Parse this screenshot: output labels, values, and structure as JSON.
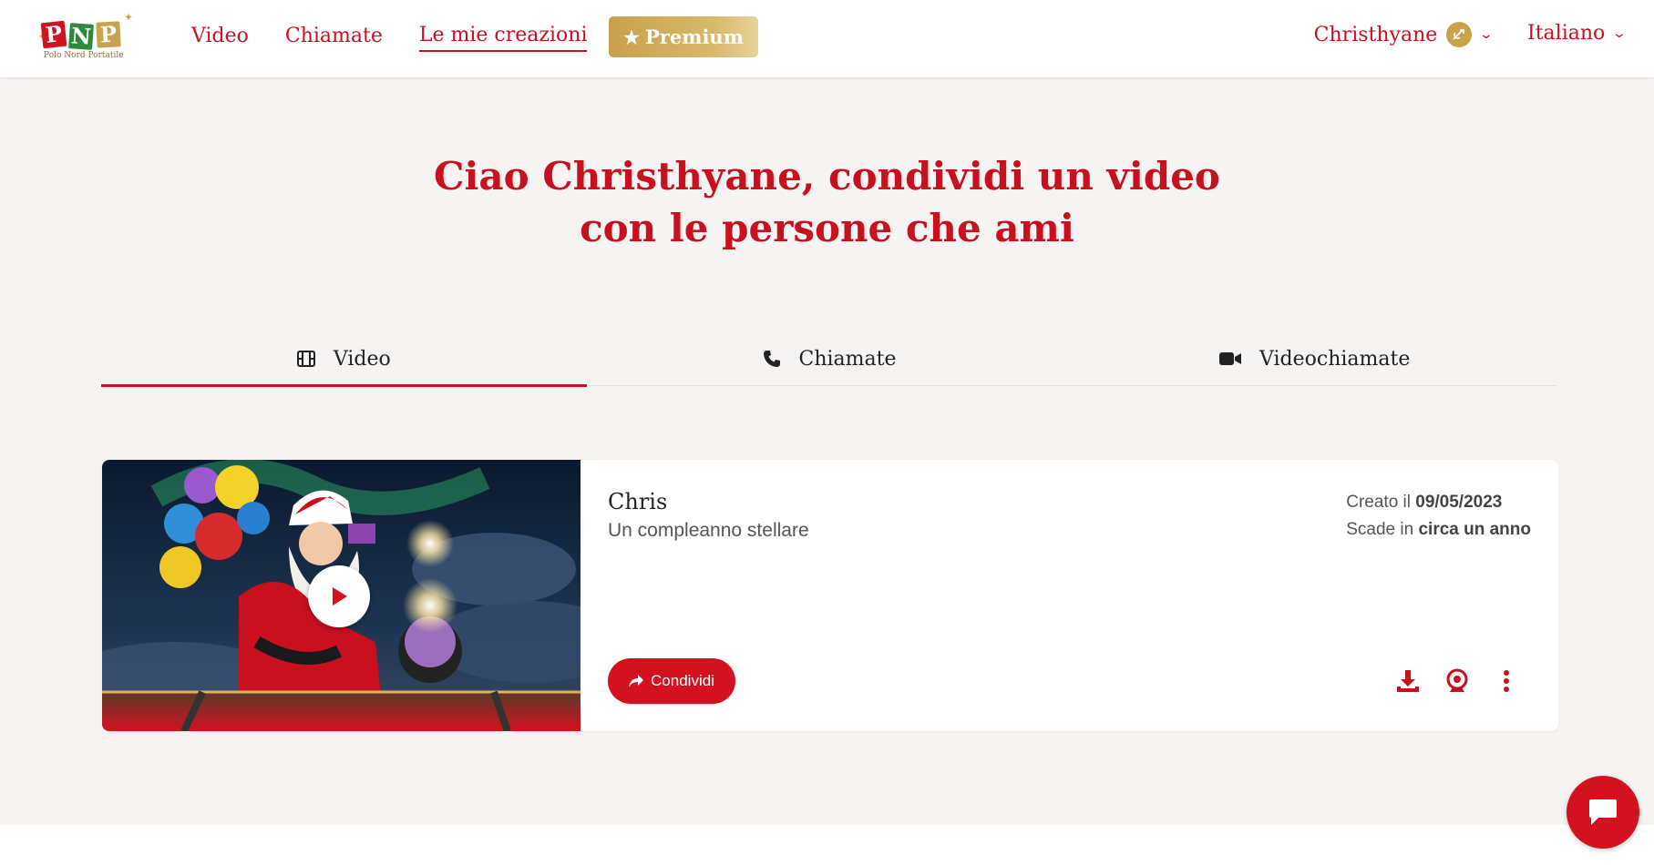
{
  "header": {
    "logo": {
      "text": "PNP",
      "letters": [
        "P",
        "N",
        "P"
      ],
      "subtitle": "Polo Nord Portatile"
    },
    "nav": [
      {
        "label": "Video"
      },
      {
        "label": "Chiamate"
      },
      {
        "label": "Le mie creazioni",
        "active": true
      }
    ],
    "premium_label": "Premium",
    "user_name": "Christhyane",
    "language": "Italiano"
  },
  "hero": {
    "line1": "Ciao Christhyane, condividi un video",
    "line2": "con le persone che ami"
  },
  "tabs": [
    {
      "label": "Video",
      "icon": "film-icon",
      "active": true
    },
    {
      "label": "Chiamate",
      "icon": "phone-icon",
      "active": false
    },
    {
      "label": "Videochiamate",
      "icon": "videocam-icon",
      "active": false
    }
  ],
  "creation": {
    "title": "Chris",
    "subtitle": "Un compleanno stellare",
    "created_prefix": "Creato il",
    "created_date": "09/05/2023",
    "expires_prefix": "Scade in",
    "expires_value": "circa un anno",
    "share_label": "Condividi",
    "actions": [
      "download-icon",
      "webcam-icon",
      "more-vertical-icon"
    ]
  },
  "colors": {
    "brand_red": "#c8101e",
    "premium_gold": "#c9a24b",
    "background": "#f6f4f3"
  }
}
